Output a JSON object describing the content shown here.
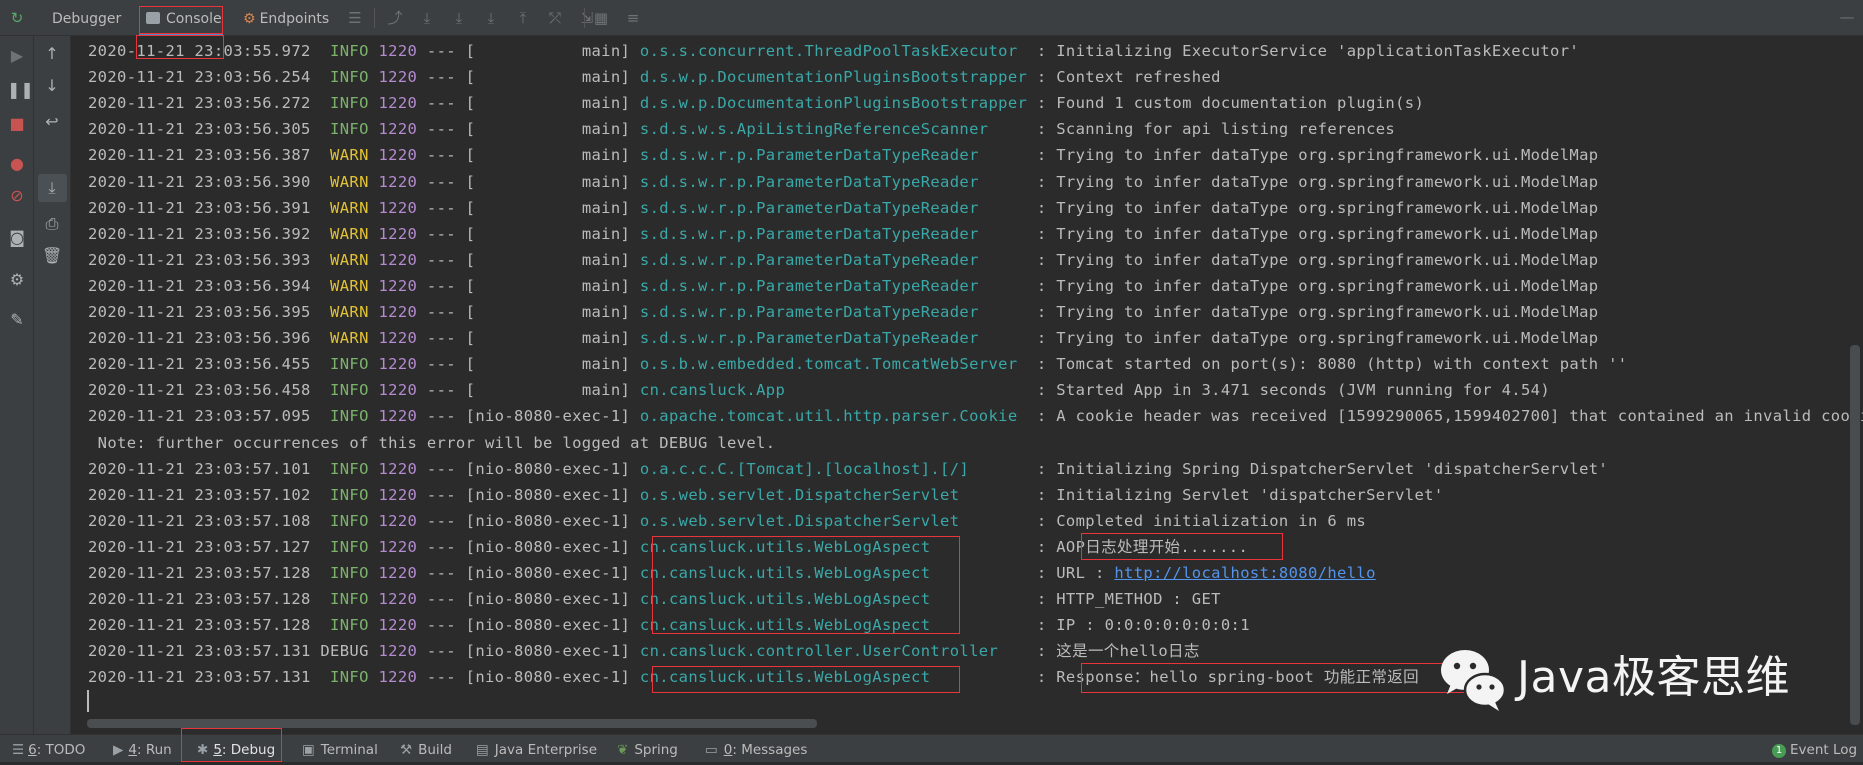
{
  "toolbar": {
    "tabs": [
      {
        "label": "Debugger"
      },
      {
        "label": "Console"
      },
      {
        "label": "Endpoints"
      }
    ]
  },
  "console": {
    "lines": [
      {
        "ts": "2020-11-21 23:03:55.972",
        "level": " INFO",
        "pid": "1220",
        "sep": " --- ",
        "thread": "[           main]",
        "logger": "o.s.s.concurrent.ThreadPoolTaskExecutor ",
        "msg": " : Initializing ExecutorService 'applicationTaskExecutor'"
      },
      {
        "ts": "2020-11-21 23:03:56.254",
        "level": " INFO",
        "pid": "1220",
        "sep": " --- ",
        "thread": "[           main]",
        "logger": "d.s.w.p.DocumentationPluginsBootstrapper",
        "msg": " : Context refreshed"
      },
      {
        "ts": "2020-11-21 23:03:56.272",
        "level": " INFO",
        "pid": "1220",
        "sep": " --- ",
        "thread": "[           main]",
        "logger": "d.s.w.p.DocumentationPluginsBootstrapper",
        "msg": " : Found 1 custom documentation plugin(s)"
      },
      {
        "ts": "2020-11-21 23:03:56.305",
        "level": " INFO",
        "pid": "1220",
        "sep": " --- ",
        "thread": "[           main]",
        "logger": "s.d.s.w.s.ApiListingReferenceScanner    ",
        "msg": " : Scanning for api listing references"
      },
      {
        "ts": "2020-11-21 23:03:56.387",
        "level": " WARN",
        "pid": "1220",
        "sep": " --- ",
        "thread": "[           main]",
        "logger": "s.d.s.w.r.p.ParameterDataTypeReader     ",
        "msg": " : Trying to infer dataType org.springframework.ui.ModelMap"
      },
      {
        "ts": "2020-11-21 23:03:56.390",
        "level": " WARN",
        "pid": "1220",
        "sep": " --- ",
        "thread": "[           main]",
        "logger": "s.d.s.w.r.p.ParameterDataTypeReader     ",
        "msg": " : Trying to infer dataType org.springframework.ui.ModelMap"
      },
      {
        "ts": "2020-11-21 23:03:56.391",
        "level": " WARN",
        "pid": "1220",
        "sep": " --- ",
        "thread": "[           main]",
        "logger": "s.d.s.w.r.p.ParameterDataTypeReader     ",
        "msg": " : Trying to infer dataType org.springframework.ui.ModelMap"
      },
      {
        "ts": "2020-11-21 23:03:56.392",
        "level": " WARN",
        "pid": "1220",
        "sep": " --- ",
        "thread": "[           main]",
        "logger": "s.d.s.w.r.p.ParameterDataTypeReader     ",
        "msg": " : Trying to infer dataType org.springframework.ui.ModelMap"
      },
      {
        "ts": "2020-11-21 23:03:56.393",
        "level": " WARN",
        "pid": "1220",
        "sep": " --- ",
        "thread": "[           main]",
        "logger": "s.d.s.w.r.p.ParameterDataTypeReader     ",
        "msg": " : Trying to infer dataType org.springframework.ui.ModelMap"
      },
      {
        "ts": "2020-11-21 23:03:56.394",
        "level": " WARN",
        "pid": "1220",
        "sep": " --- ",
        "thread": "[           main]",
        "logger": "s.d.s.w.r.p.ParameterDataTypeReader     ",
        "msg": " : Trying to infer dataType org.springframework.ui.ModelMap"
      },
      {
        "ts": "2020-11-21 23:03:56.395",
        "level": " WARN",
        "pid": "1220",
        "sep": " --- ",
        "thread": "[           main]",
        "logger": "s.d.s.w.r.p.ParameterDataTypeReader     ",
        "msg": " : Trying to infer dataType org.springframework.ui.ModelMap"
      },
      {
        "ts": "2020-11-21 23:03:56.396",
        "level": " WARN",
        "pid": "1220",
        "sep": " --- ",
        "thread": "[           main]",
        "logger": "s.d.s.w.r.p.ParameterDataTypeReader     ",
        "msg": " : Trying to infer dataType org.springframework.ui.ModelMap"
      },
      {
        "ts": "2020-11-21 23:03:56.455",
        "level": " INFO",
        "pid": "1220",
        "sep": " --- ",
        "thread": "[           main]",
        "logger": "o.s.b.w.embedded.tomcat.TomcatWebServer ",
        "msg": " : Tomcat started on port(s): 8080 (http) with context path ''"
      },
      {
        "ts": "2020-11-21 23:03:56.458",
        "level": " INFO",
        "pid": "1220",
        "sep": " --- ",
        "thread": "[           main]",
        "logger": "cn.cansluck.App                         ",
        "msg": " : Started App in 3.471 seconds (JVM running for 4.54)"
      },
      {
        "ts": "2020-11-21 23:03:57.095",
        "level": " INFO",
        "pid": "1220",
        "sep": " --- ",
        "thread": "[nio-8080-exec-1]",
        "logger": "o.apache.tomcat.util.http.parser.Cookie ",
        "msg": " : A cookie header was received [1599290065,1599402700] that contained an invalid cookie. That cookie will be ignored."
      },
      {
        "plain": " Note: further occurrences of this error will be logged at DEBUG level."
      },
      {
        "ts": "2020-11-21 23:03:57.101",
        "level": " INFO",
        "pid": "1220",
        "sep": " --- ",
        "thread": "[nio-8080-exec-1]",
        "logger": "o.a.c.c.C.[Tomcat].[localhost].[/]      ",
        "msg": " : Initializing Spring DispatcherServlet 'dispatcherServlet'"
      },
      {
        "ts": "2020-11-21 23:03:57.102",
        "level": " INFO",
        "pid": "1220",
        "sep": " --- ",
        "thread": "[nio-8080-exec-1]",
        "logger": "o.s.web.servlet.DispatcherServlet       ",
        "msg": " : Initializing Servlet 'dispatcherServlet'"
      },
      {
        "ts": "2020-11-21 23:03:57.108",
        "level": " INFO",
        "pid": "1220",
        "sep": " --- ",
        "thread": "[nio-8080-exec-1]",
        "logger": "o.s.web.servlet.DispatcherServlet       ",
        "msg": " : Completed initialization in 6 ms"
      },
      {
        "ts": "2020-11-21 23:03:57.127",
        "level": " INFO",
        "pid": "1220",
        "sep": " --- ",
        "thread": "[nio-8080-exec-1]",
        "logger": "cn.cansluck.utils.WebLogAspect          ",
        "msg": " : AOP日志处理开始......."
      },
      {
        "ts": "2020-11-21 23:03:57.128",
        "level": " INFO",
        "pid": "1220",
        "sep": " --- ",
        "thread": "[nio-8080-exec-1]",
        "logger": "cn.cansluck.utils.WebLogAspect          ",
        "msg": " : URL : ",
        "link": "http://localhost:8080/hello"
      },
      {
        "ts": "2020-11-21 23:03:57.128",
        "level": " INFO",
        "pid": "1220",
        "sep": " --- ",
        "thread": "[nio-8080-exec-1]",
        "logger": "cn.cansluck.utils.WebLogAspect          ",
        "msg": " : HTTP_METHOD : GET"
      },
      {
        "ts": "2020-11-21 23:03:57.128",
        "level": " INFO",
        "pid": "1220",
        "sep": " --- ",
        "thread": "[nio-8080-exec-1]",
        "logger": "cn.cansluck.utils.WebLogAspect          ",
        "msg": " : IP : 0:0:0:0:0:0:0:1"
      },
      {
        "ts": "2020-11-21 23:03:57.131",
        "level": "DEBUG",
        "pid": "1220",
        "sep": " --- ",
        "thread": "[nio-8080-exec-1]",
        "logger": "cn.cansluck.controller.UserController   ",
        "msg": " : 这是一个hello日志"
      },
      {
        "ts": "2020-11-21 23:03:57.131",
        "level": " INFO",
        "pid": "1220",
        "sep": " --- ",
        "thread": "[nio-8080-exec-1]",
        "logger": "cn.cansluck.utils.WebLogAspect          ",
        "msg": " : Response：hello spring-boot 功能正常返回"
      }
    ]
  },
  "bottombar": {
    "items": [
      {
        "num": "6",
        "label": ": TODO"
      },
      {
        "num": "4",
        "label": ": Run"
      },
      {
        "num": "5",
        "label": ": Debug"
      },
      {
        "num": "",
        "label": "Terminal"
      },
      {
        "num": "",
        "label": "Build"
      },
      {
        "num": "",
        "label": "Java Enterprise"
      },
      {
        "num": "",
        "label": "Spring"
      },
      {
        "num": "0",
        "label": ": Messages"
      }
    ],
    "event_log": {
      "badge": "1",
      "label": "Event Log"
    }
  },
  "watermark": {
    "text": "Java极客思维"
  },
  "colors": {
    "info": "#7cb36b",
    "warn": "#e1c234",
    "pid": "#b58bd1",
    "logger": "#3aa8a8",
    "link": "#5394ec",
    "highlight": "#e8343a"
  }
}
